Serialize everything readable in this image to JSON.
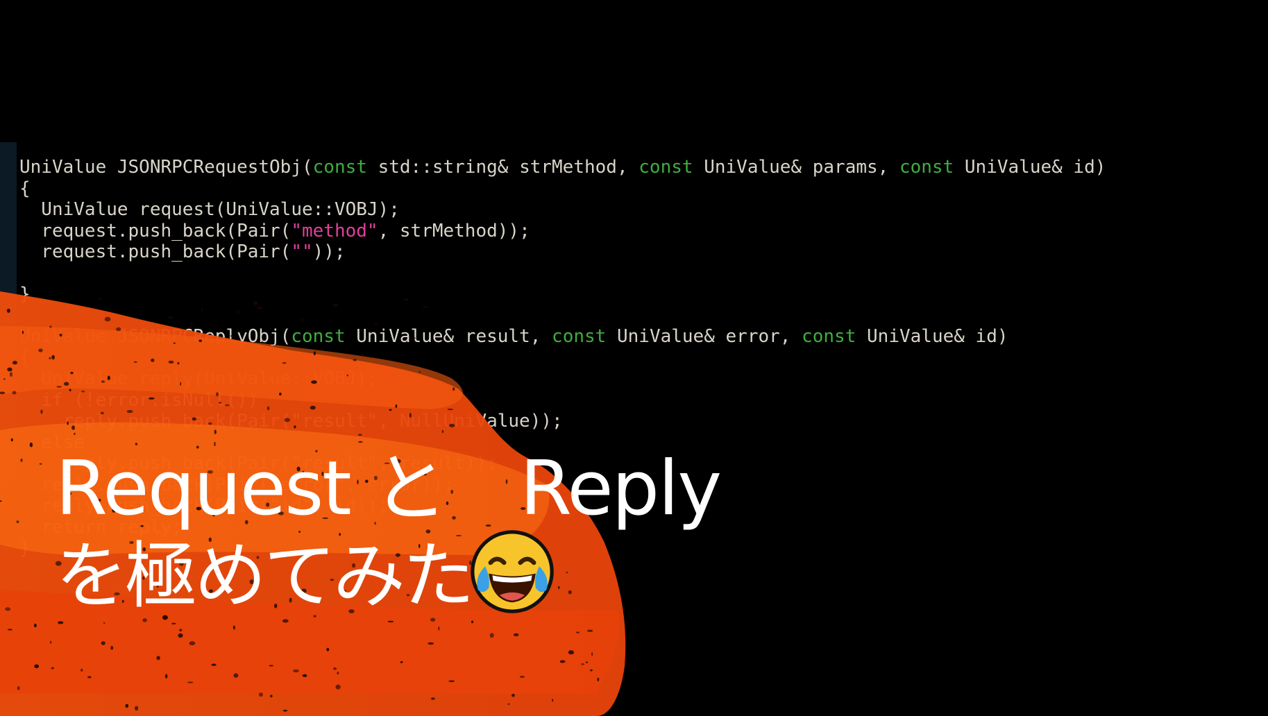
{
  "code": {
    "lines": [
      [
        {
          "t": "UniValue JSONRPCRequestObj(",
          "c": "plain"
        },
        {
          "t": "const",
          "c": "kw"
        },
        {
          "t": " std::string& strMethod, ",
          "c": "plain"
        },
        {
          "t": "const",
          "c": "kw"
        },
        {
          "t": " UniValue& params, ",
          "c": "plain"
        },
        {
          "t": "const",
          "c": "kw"
        },
        {
          "t": " UniValue& id)",
          "c": "plain"
        }
      ],
      [
        {
          "t": "{",
          "c": "plain"
        }
      ],
      [
        {
          "t": "  UniValue request(UniValue::VOBJ);",
          "c": "plain"
        }
      ],
      [
        {
          "t": "  request.push_back(Pair(",
          "c": "plain"
        },
        {
          "t": "\"method\"",
          "c": "str"
        },
        {
          "t": ", strMethod));",
          "c": "plain"
        }
      ],
      [
        {
          "t": "  request.push_back(Pair(",
          "c": "plain"
        },
        {
          "t": "\"\"",
          "c": "str"
        },
        {
          "t": "));",
          "c": "plain"
        }
      ],
      [
        {
          "t": "",
          "c": "plain"
        }
      ],
      [
        {
          "t": "}",
          "c": "plain"
        }
      ],
      [
        {
          "t": "",
          "c": "plain"
        }
      ],
      [
        {
          "t": "UniValue JSONRPCReplyObj(",
          "c": "plain"
        },
        {
          "t": "const",
          "c": "kw"
        },
        {
          "t": " UniValue& result, ",
          "c": "plain"
        },
        {
          "t": "const",
          "c": "kw"
        },
        {
          "t": " UniValue& error, ",
          "c": "plain"
        },
        {
          "t": "const",
          "c": "kw"
        },
        {
          "t": " UniValue& id)",
          "c": "plain"
        }
      ],
      [
        {
          "t": "{",
          "c": "plain"
        }
      ],
      [
        {
          "t": "  UniValue reply(UniValue::VOBJ);",
          "c": "plain"
        }
      ],
      [
        {
          "t": "  if (!error.isNull())",
          "c": "plain"
        }
      ],
      [
        {
          "t": "    reply.push_back(Pair(\"result\", NullUniValue));",
          "c": "plain"
        }
      ],
      [
        {
          "t": "  else",
          "c": "plain"
        }
      ],
      [
        {
          "t": "    reply.push_back(Pair(\"result\", result));",
          "c": "plain"
        }
      ],
      [
        {
          "t": "  reply.push_back(Pair(\"error\", error));",
          "c": "plain"
        }
      ],
      [
        {
          "t": "  reply.push_back(Pair(\"id\", id));",
          "c": "plain"
        }
      ],
      [
        {
          "t": "  return reply;",
          "c": "plain"
        }
      ],
      [
        {
          "t": "}",
          "c": "plain"
        }
      ]
    ]
  },
  "title": {
    "line1": "Request と　Reply",
    "line2": "を極めてみた"
  },
  "emoji": "face-with-tears-of-joy-icon",
  "colors": {
    "background": "#000000",
    "brush": "#e9480a",
    "brush_light": "#ff7a1a",
    "keyword": "#3fae3f",
    "string": "#e0409a",
    "code_text": "#d8d4c8",
    "title_text": "#ffffff"
  }
}
